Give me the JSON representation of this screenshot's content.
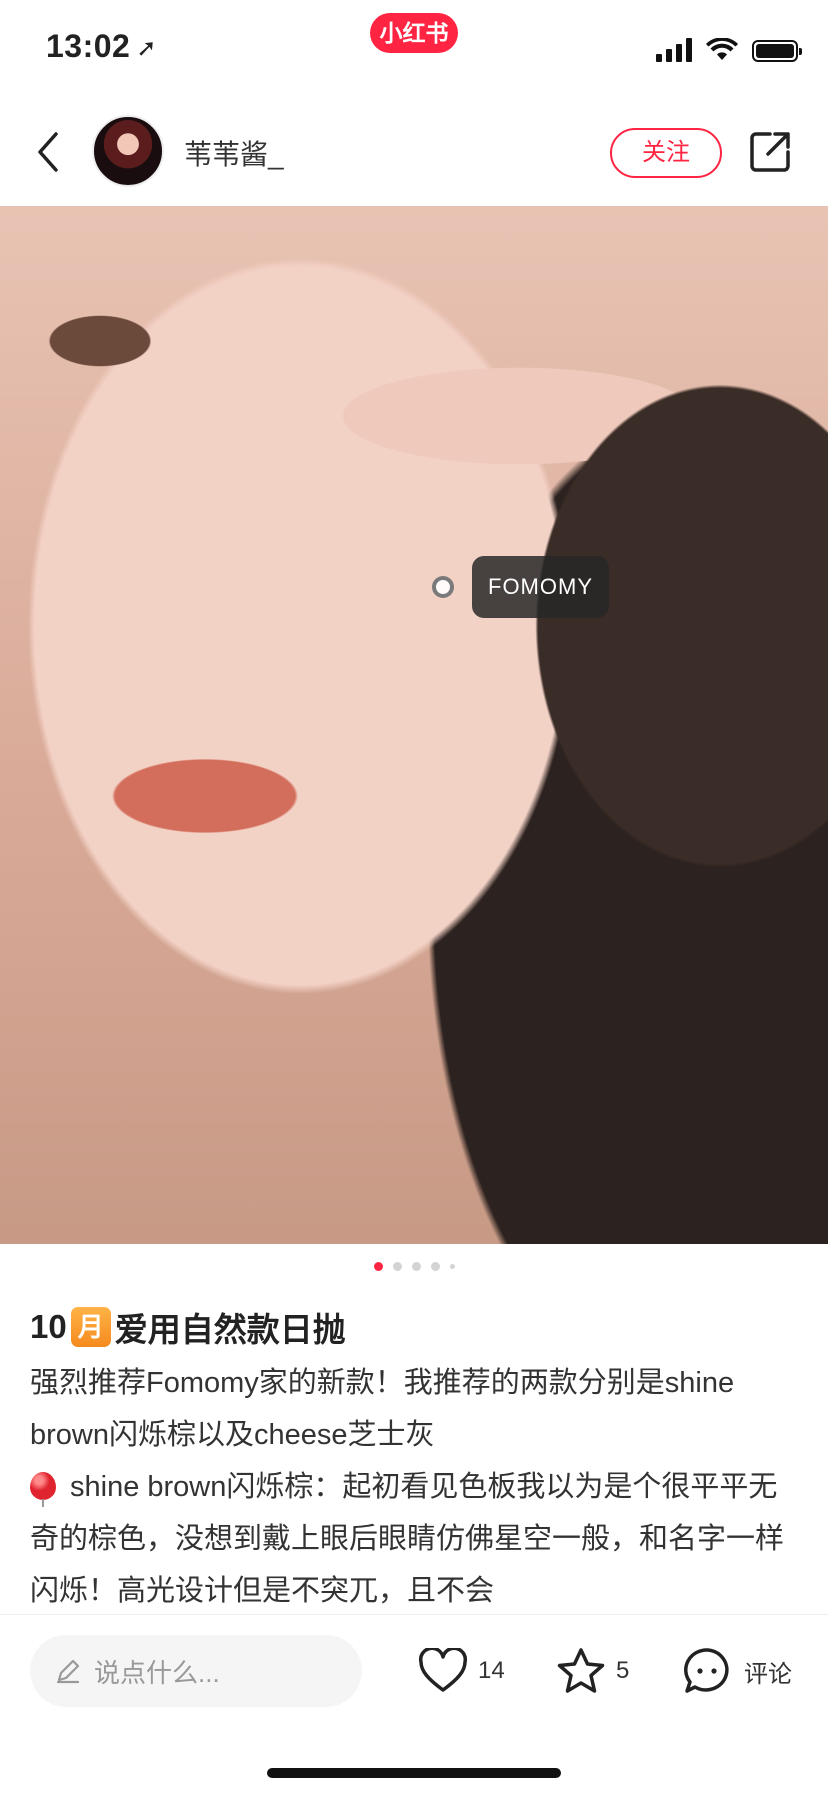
{
  "status_bar": {
    "time": "13:02",
    "app_badge": "小红书"
  },
  "header": {
    "back_icon": "chevron-left-icon",
    "username": "苇苇酱_",
    "follow_label": "关注",
    "share_icon": "share-icon"
  },
  "photo": {
    "tag_label": "FOMOMY",
    "pager": {
      "total_pages": 5,
      "current_page": 1
    }
  },
  "note": {
    "title_prefix": "10",
    "title_emoji": "月",
    "title_rest": "爱用自然款日抛",
    "paragraphs": [
      "强烈推荐Fomomy家的新款！我推荐的两款分别是shine brown闪烁棕以及cheese芝士灰",
      "shine brown闪烁棕：起初看见色板我以为是个很平平无奇的棕色，没想到戴上眼后眼睛仿佛星空一般，和名字一样闪烁！高光设计但是不突兀，且不会"
    ]
  },
  "bottom_bar": {
    "comment_placeholder": "说点什么...",
    "like_count": "14",
    "star_count": "5",
    "comment_label": "评论"
  },
  "colors": {
    "accent": "#ff2442"
  }
}
